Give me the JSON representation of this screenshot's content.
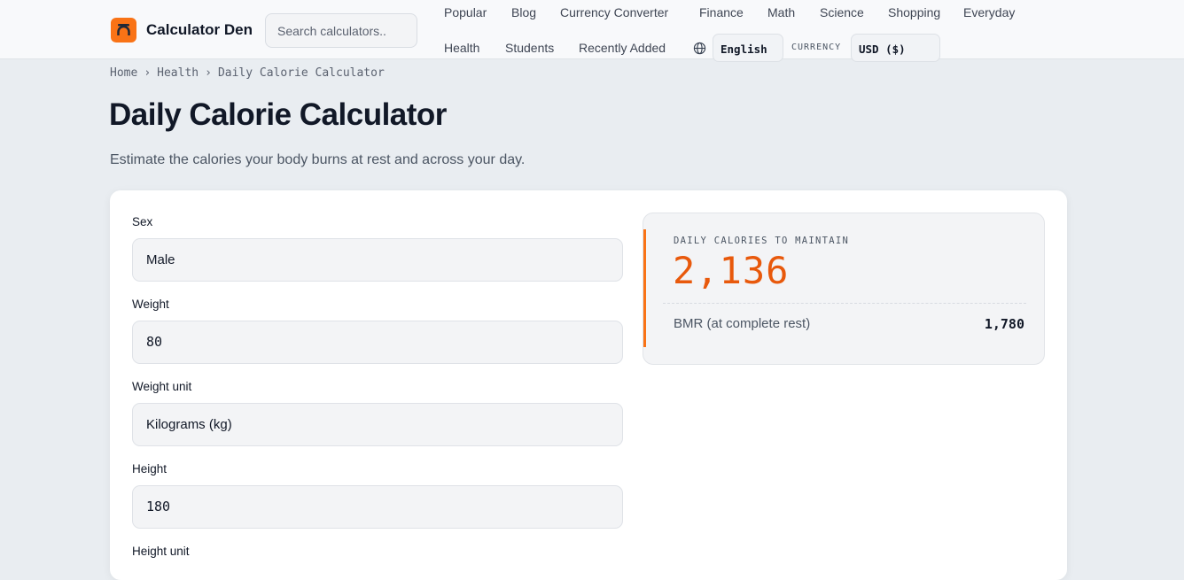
{
  "header": {
    "brand": "Calculator Den",
    "search_placeholder": "Search calculators..",
    "nav": [
      "Popular",
      "Blog",
      "Currency Converter",
      "Finance",
      "Math",
      "Science",
      "Shopping",
      "Everyday",
      "Health",
      "Students",
      "Recently Added"
    ],
    "language": "English",
    "currency_label": "CURRENCY",
    "currency": "USD ($)"
  },
  "breadcrumb": [
    "Home",
    "Health",
    "Daily Calorie Calculator"
  ],
  "breadcrumb_sep": "›",
  "page": {
    "title": "Daily Calorie Calculator",
    "subtitle": "Estimate the calories your body burns at rest and across your day."
  },
  "form": {
    "sex": {
      "label": "Sex",
      "value": "Male"
    },
    "weight": {
      "label": "Weight",
      "value": "80"
    },
    "weight_unit": {
      "label": "Weight unit",
      "value": "Kilograms (kg)"
    },
    "height": {
      "label": "Height",
      "value": "180"
    },
    "height_unit": {
      "label": "Height unit"
    }
  },
  "result": {
    "label": "DAILY CALORIES TO MAINTAIN",
    "value": "2,136",
    "bmr_label": "BMR (at complete rest)",
    "bmr_value": "1,780"
  },
  "colors": {
    "accent": "#f97316",
    "result_value": "#e8590c"
  },
  "icons": {
    "logo": "calculator-den-logo-icon",
    "language": "globe-icon"
  }
}
